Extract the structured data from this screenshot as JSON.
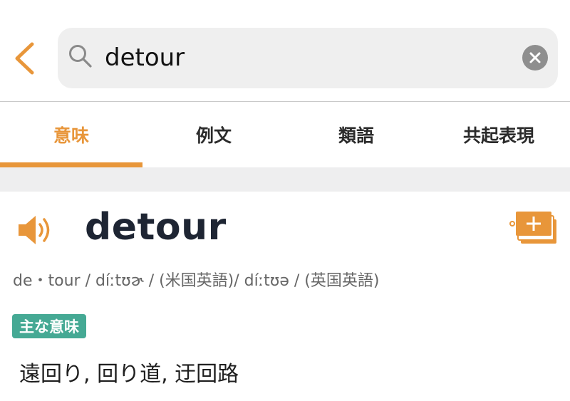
{
  "search": {
    "value": "detour",
    "back_icon": "chevron-left-icon",
    "search_icon": "magnifier-icon",
    "clear_icon": "clear-x-icon"
  },
  "tabs": [
    {
      "label": "意味",
      "active": true
    },
    {
      "label": "例文",
      "active": false
    },
    {
      "label": "類語",
      "active": false
    },
    {
      "label": "共起表現",
      "active": false
    }
  ],
  "entry": {
    "headword": "detour",
    "pronunciation": "de・tour / díːtʊɚ / (米国英語)/ díːtʊə / (英国英語)",
    "badge": "主な意味",
    "meaning": "遠回り, 回り道, 迂回路",
    "speaker_icon": "speaker-icon",
    "wordbook_icon": "add-to-wordbook-icon"
  },
  "colors": {
    "accent": "#e8963a",
    "badge": "#45a994",
    "headword": "#1e2533",
    "search_bg": "#efefef"
  }
}
